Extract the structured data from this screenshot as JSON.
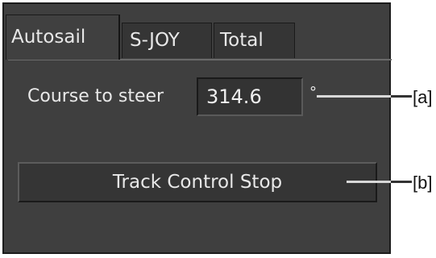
{
  "tabs": [
    {
      "label": "Autosail",
      "active": true
    },
    {
      "label": "S-JOY",
      "active": false
    },
    {
      "label": "Total",
      "active": false
    }
  ],
  "course": {
    "label": "Course to steer",
    "value": "314.6",
    "unit": "°"
  },
  "track_button": {
    "label": "Track Control Stop"
  },
  "callouts": {
    "a": "[a]",
    "b": "[b]"
  },
  "colors": {
    "panel_background": "#3f3f3f",
    "text": "#e8e8e8",
    "leader_line": "#d8d8d8"
  }
}
